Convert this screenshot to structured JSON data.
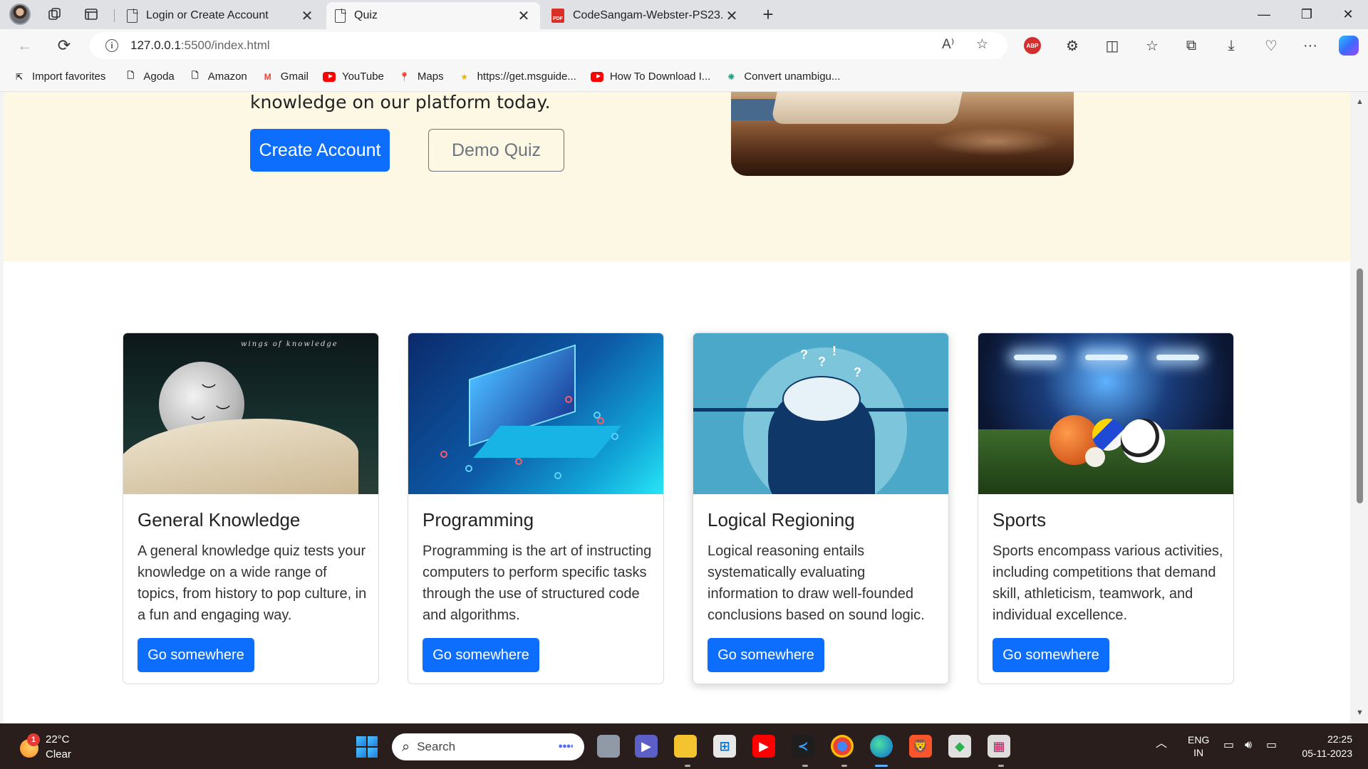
{
  "browser": {
    "tabs": [
      {
        "title": "Login or Create Account",
        "icon": "page-icon",
        "close": "✕"
      },
      {
        "title": "Quiz",
        "icon": "page-icon",
        "close": "✕",
        "active": true
      },
      {
        "title": "CodeSangam-Webster-PS23.pdf",
        "icon": "pdf-icon",
        "close": "✕"
      }
    ],
    "new_tab": "+",
    "url_host": "127.0.0.1",
    "url_path": ":5500/index.html",
    "window_controls": {
      "minimize": "—",
      "maximize": "❐",
      "close": "✕"
    },
    "pdf_badge": "PDF",
    "abp_badge": "ABP"
  },
  "favorites": [
    {
      "label": "Import favorites",
      "icon": "import-icon"
    },
    {
      "label": "Agoda",
      "icon": "page-icon"
    },
    {
      "label": "Amazon",
      "icon": "page-icon"
    },
    {
      "label": "Gmail",
      "icon": "gmail-icon"
    },
    {
      "label": "YouTube",
      "icon": "youtube-icon"
    },
    {
      "label": "Maps",
      "icon": "maps-icon"
    },
    {
      "label": "https://get.msguide...",
      "icon": "star-icon"
    },
    {
      "label": "How To Download I...",
      "icon": "youtube-icon"
    },
    {
      "label": "Convert unambigu...",
      "icon": "chatgpt-icon"
    }
  ],
  "hero": {
    "text": "knowledge on our platform today.",
    "create_button": "Create Account",
    "demo_button": "Demo Quiz"
  },
  "cards": [
    {
      "title": "General Knowledge",
      "text": "A general knowledge quiz tests your knowledge on a wide range of topics, from history to pop culture, in a fun and engaging way.",
      "button": "Go somewhere",
      "image_caption": "wings of knowledge"
    },
    {
      "title": "Programming",
      "text": "Programming is the art of instructing computers to perform specific tasks through the use of structured code and algorithms.",
      "button": "Go somewhere"
    },
    {
      "title": "Logical Regioning",
      "text": "Logical reasoning entails systematically evaluating information to draw well-founded conclusions based on sound logic.",
      "button": "Go somewhere"
    },
    {
      "title": "Sports",
      "text": "Sports encompass various activities, including competitions that demand skill, athleticism, teamwork, and individual excellence.",
      "button": "Go somewhere"
    }
  ],
  "taskbar": {
    "weather_temp": "22°C",
    "weather_cond": "Clear",
    "weather_badge": "1",
    "search_label": "Search",
    "language_line1": "ENG",
    "language_line2": "IN",
    "time": "22:25",
    "date": "05-11-2023"
  },
  "colors": {
    "primary": "#0d6efd",
    "hero_bg": "#fdf8e4",
    "taskbar_bg": "#2a1e1c"
  }
}
